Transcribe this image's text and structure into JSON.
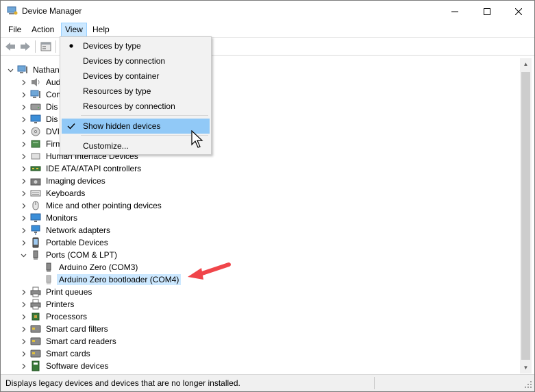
{
  "window": {
    "title": "Device Manager"
  },
  "menubar": [
    "File",
    "Action",
    "View",
    "Help"
  ],
  "view_menu": {
    "items": [
      {
        "label": "Devices by type",
        "mark": "bullet"
      },
      {
        "label": "Devices by connection",
        "mark": ""
      },
      {
        "label": "Devices by container",
        "mark": ""
      },
      {
        "label": "Resources by type",
        "mark": ""
      },
      {
        "label": "Resources by connection",
        "mark": ""
      },
      {
        "label": "Show hidden devices",
        "mark": "check"
      },
      {
        "label": "Customize...",
        "mark": ""
      }
    ]
  },
  "tree": {
    "root": "Nathan",
    "partial_labels": [
      "Audio inputs and outputs",
      "Com",
      "Dis",
      "Dis",
      "DVI",
      "Firm",
      "Human Interface Devices"
    ],
    "rows": [
      {
        "label": "Nathan",
        "level": 0,
        "expanded": true,
        "icon": "computer-icon"
      },
      {
        "label": "Aud",
        "level": 1,
        "expanded": false,
        "icon": "speaker-icon"
      },
      {
        "label": "Com",
        "level": 1,
        "expanded": false,
        "icon": "computer-icon"
      },
      {
        "label": "Dis",
        "level": 1,
        "expanded": false,
        "icon": "disk-icon"
      },
      {
        "label": "Dis",
        "level": 1,
        "expanded": false,
        "icon": "monitor-icon"
      },
      {
        "label": "DVI",
        "level": 1,
        "expanded": false,
        "icon": "dvd-icon"
      },
      {
        "label": "Firm",
        "level": 1,
        "expanded": false,
        "icon": "firmware-icon"
      },
      {
        "label": "Human Interface Devices",
        "level": 1,
        "expanded": false,
        "icon": "hid-icon"
      },
      {
        "label": "IDE ATA/ATAPI controllers",
        "level": 1,
        "expanded": false,
        "icon": "ide-icon"
      },
      {
        "label": "Imaging devices",
        "level": 1,
        "expanded": false,
        "icon": "camera-icon"
      },
      {
        "label": "Keyboards",
        "level": 1,
        "expanded": false,
        "icon": "keyboard-icon"
      },
      {
        "label": "Mice and other pointing devices",
        "level": 1,
        "expanded": false,
        "icon": "mouse-icon"
      },
      {
        "label": "Monitors",
        "level": 1,
        "expanded": false,
        "icon": "monitor-icon"
      },
      {
        "label": "Network adapters",
        "level": 1,
        "expanded": false,
        "icon": "network-icon"
      },
      {
        "label": "Portable Devices",
        "level": 1,
        "expanded": false,
        "icon": "portable-icon"
      },
      {
        "label": "Ports (COM & LPT)",
        "level": 1,
        "expanded": true,
        "icon": "port-icon"
      },
      {
        "label": "Arduino Zero (COM3)",
        "level": 2,
        "expanded": null,
        "icon": "port-icon"
      },
      {
        "label": "Arduino Zero bootloader (COM4)",
        "level": 2,
        "expanded": null,
        "icon": "port-icon",
        "selected": true,
        "ghost": true
      },
      {
        "label": "Print queues",
        "level": 1,
        "expanded": false,
        "icon": "printer-icon"
      },
      {
        "label": "Printers",
        "level": 1,
        "expanded": false,
        "icon": "printer-icon"
      },
      {
        "label": "Processors",
        "level": 1,
        "expanded": false,
        "icon": "cpu-icon"
      },
      {
        "label": "Smart card filters",
        "level": 1,
        "expanded": false,
        "icon": "smartcard-icon"
      },
      {
        "label": "Smart card readers",
        "level": 1,
        "expanded": false,
        "icon": "smartcard-icon"
      },
      {
        "label": "Smart cards",
        "level": 1,
        "expanded": false,
        "icon": "smartcard-icon"
      },
      {
        "label": "Software devices",
        "level": 1,
        "expanded": false,
        "icon": "software-icon"
      }
    ]
  },
  "status": {
    "text": "Displays legacy devices and devices that are no longer installed."
  },
  "colors": {
    "selection": "#cce8ff",
    "menu_hover": "#91c9f7",
    "annotation_arrow": "#f0454a"
  }
}
